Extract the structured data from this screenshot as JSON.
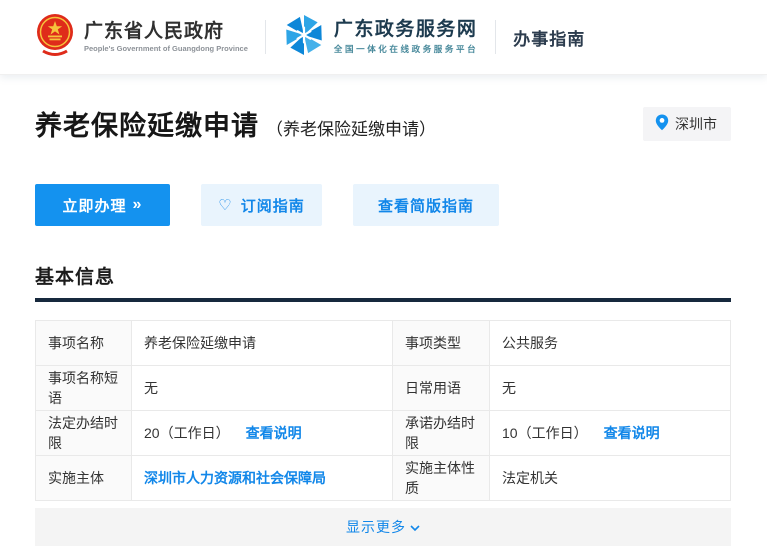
{
  "header": {
    "gov": {
      "title": "广东省人民政府",
      "subtitle": "People's Government of Guangdong Province"
    },
    "portal": {
      "title": "广东政务服务网",
      "subtitle": "全国一体化在线政务服务平台"
    },
    "nav": "办事指南"
  },
  "page": {
    "title": "养老保险延缴申请",
    "subtitle": "（养老保险延缴申请）",
    "city": "深圳市"
  },
  "actions": {
    "apply": "立即办理",
    "subscribe": "订阅指南",
    "simple_guide": "查看简版指南"
  },
  "icons": {
    "heart": "♡",
    "double_arrow": "»"
  },
  "section": {
    "title": "基本信息"
  },
  "table": {
    "rows": [
      {
        "label1": "事项名称",
        "value1": "养老保险延缴申请",
        "label2": "事项类型",
        "value2": "公共服务"
      },
      {
        "label1": "事项名称短语",
        "value1": "无",
        "label2": "日常用语",
        "value2": "无"
      },
      {
        "label1": "法定办结时限",
        "value1": "20（工作日）",
        "link1": "查看说明",
        "label2": "承诺办结时限",
        "value2": "10（工作日）",
        "link2": "查看说明"
      },
      {
        "label1": "实施主体",
        "link1": "深圳市人力资源和社会保障局",
        "label2": "实施主体性质",
        "value2": "法定机关"
      }
    ]
  },
  "footer": {
    "show_more": "显示更多"
  },
  "colors": {
    "accent": "#1492ef",
    "accent_light_bg": "#e9f4fd",
    "link": "#1287e9",
    "dark_bar": "#17293d"
  }
}
